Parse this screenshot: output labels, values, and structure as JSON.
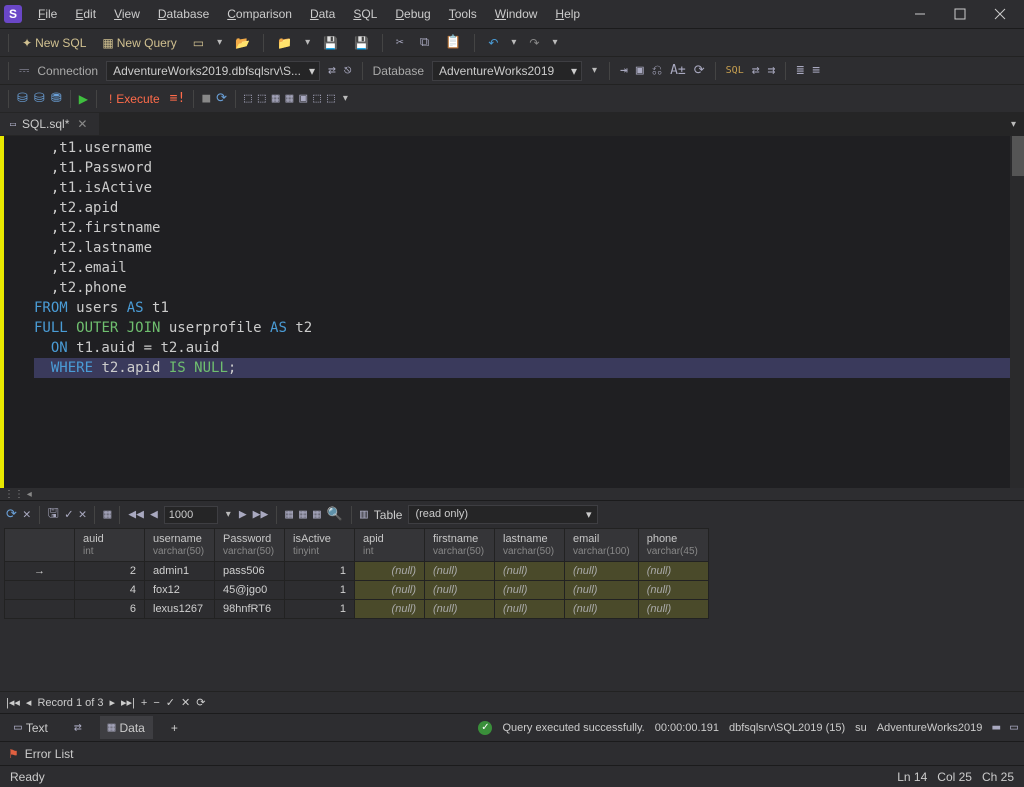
{
  "app": {
    "icon_letter": "S"
  },
  "menu": [
    "File",
    "Edit",
    "View",
    "Database",
    "Comparison",
    "Data",
    "SQL",
    "Debug",
    "Tools",
    "Window",
    "Help"
  ],
  "toolbar1": {
    "new_sql": "New SQL",
    "new_query": "New Query"
  },
  "connection": {
    "label": "Connection",
    "value": "AdventureWorks2019.dbfsqlsrv\\S...",
    "db_label": "Database",
    "db_value": "AdventureWorks2019"
  },
  "execute_label": "Execute",
  "tab": {
    "name": "SQL.sql*"
  },
  "code_lines": [
    {
      "indent": "  ",
      "pre": ",",
      "id": "t1",
      "dot": ".",
      "col": "username"
    },
    {
      "indent": "  ",
      "pre": ",",
      "id": "t1",
      "dot": ".",
      "col": "Password"
    },
    {
      "indent": "  ",
      "pre": ",",
      "id": "t1",
      "dot": ".",
      "col": "isActive"
    },
    {
      "indent": "  ",
      "pre": ",",
      "id": "t2",
      "dot": ".",
      "col": "apid"
    },
    {
      "indent": "  ",
      "pre": ",",
      "id": "t2",
      "dot": ".",
      "col": "firstname"
    },
    {
      "indent": "  ",
      "pre": ",",
      "id": "t2",
      "dot": ".",
      "col": "lastname"
    },
    {
      "indent": "  ",
      "pre": ",",
      "id": "t2",
      "dot": ".",
      "col": "email"
    },
    {
      "indent": "  ",
      "pre": ",",
      "id": "t2",
      "dot": ".",
      "col": "phone"
    },
    {
      "raw_from": true,
      "kw": "FROM",
      "tbl": "users",
      "as": "AS",
      "alias": "t1"
    },
    {
      "raw_join": true,
      "kw": "FULL",
      "kw2": "OUTER JOIN",
      "tbl": "userprofile",
      "as": "AS",
      "alias": "t2"
    },
    {
      "raw_on": true,
      "kw": "ON",
      "l": "t1",
      "lc": "auid",
      "r": "t2",
      "rc": "auid"
    },
    {
      "raw_where": true,
      "kw": "WHERE",
      "t": "t2",
      "c": "apid",
      "null": "IS NULL",
      "semi": ";",
      "hl": true
    }
  ],
  "results_toolbar": {
    "page_size": "1000",
    "table_label": "Table",
    "readonly": "(read only)"
  },
  "columns": [
    {
      "name": "auid",
      "type": "int"
    },
    {
      "name": "username",
      "type": "varchar(50)"
    },
    {
      "name": "Password",
      "type": "varchar(50)"
    },
    {
      "name": "isActive",
      "type": "tinyint"
    },
    {
      "name": "apid",
      "type": "int"
    },
    {
      "name": "firstname",
      "type": "varchar(50)"
    },
    {
      "name": "lastname",
      "type": "varchar(50)"
    },
    {
      "name": "email",
      "type": "varchar(100)"
    },
    {
      "name": "phone",
      "type": "varchar(45)"
    }
  ],
  "rows": [
    {
      "mark": "→",
      "auid": "2",
      "username": "admin1",
      "Password": "pass506",
      "isActive": "1",
      "apid": "(null)",
      "firstname": "(null)",
      "lastname": "(null)",
      "email": "(null)",
      "phone": "(null)"
    },
    {
      "mark": "",
      "auid": "4",
      "username": "fox12",
      "Password": "45@jgo0",
      "isActive": "1",
      "apid": "(null)",
      "firstname": "(null)",
      "lastname": "(null)",
      "email": "(null)",
      "phone": "(null)"
    },
    {
      "mark": "",
      "auid": "6",
      "username": "lexus1267",
      "Password": "98hnfRT6",
      "isActive": "1",
      "apid": "(null)",
      "firstname": "(null)",
      "lastname": "(null)",
      "email": "(null)",
      "phone": "(null)"
    }
  ],
  "record_nav": "Record 1 of 3",
  "bottom_tabs": {
    "text": "Text",
    "data": "Data"
  },
  "exec_status": {
    "msg": "Query executed successfully.",
    "time": "00:00:00.191",
    "server": "dbfsqlsrv\\SQL2019 (15)",
    "user": "su",
    "db": "AdventureWorks2019"
  },
  "error_list": "Error List",
  "status": {
    "ready": "Ready",
    "ln": "Ln 14",
    "col": "Col 25",
    "ch": "Ch 25"
  }
}
